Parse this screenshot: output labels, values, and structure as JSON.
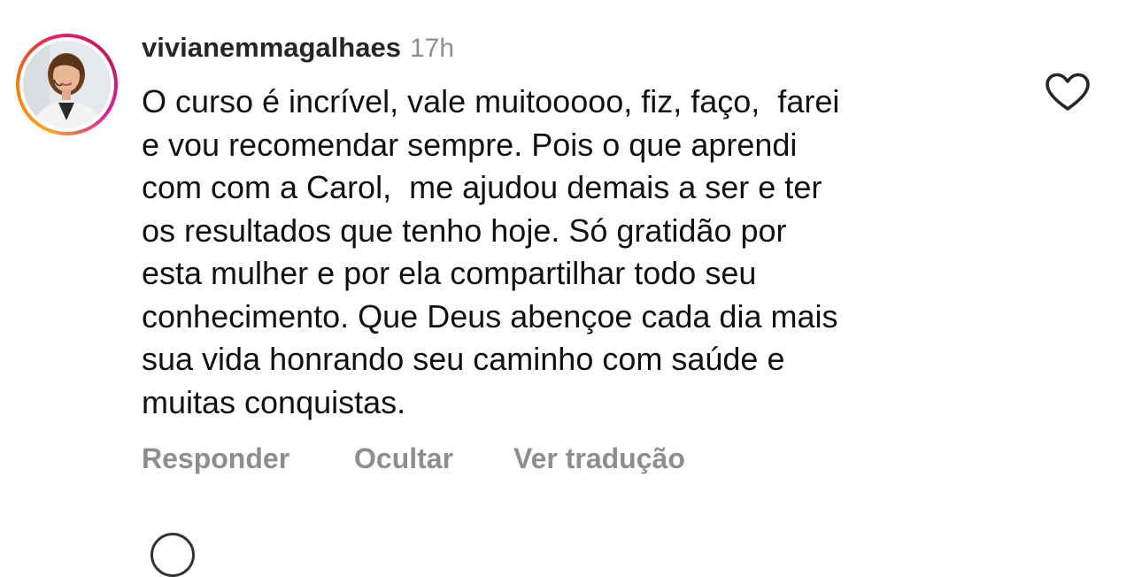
{
  "comment": {
    "username": "vivianemmagalhaes",
    "timestamp": "17h",
    "text": "O curso é incrível, vale muitooooo, fiz, faço,  farei\ne vou recomendar sempre. Pois o que aprendi\ncom com a Carol,  me ajudou demais a ser e ter\nos resultados que tenho hoje. Só gratidão por\nesta mulher e por ela compartilhar todo seu\nconhecimento. Que Deus abençoe cada dia mais\nsua vida honrando seu caminho com saúde e\nmuitas conquistas.",
    "like_icon": "heart-outline-icon",
    "story_ring_colors": [
      "#f9a825",
      "#e91e63",
      "#d6249f"
    ]
  },
  "actions": {
    "reply_label": "Responder",
    "hide_label": "Ocultar",
    "translate_label": "Ver tradução"
  }
}
